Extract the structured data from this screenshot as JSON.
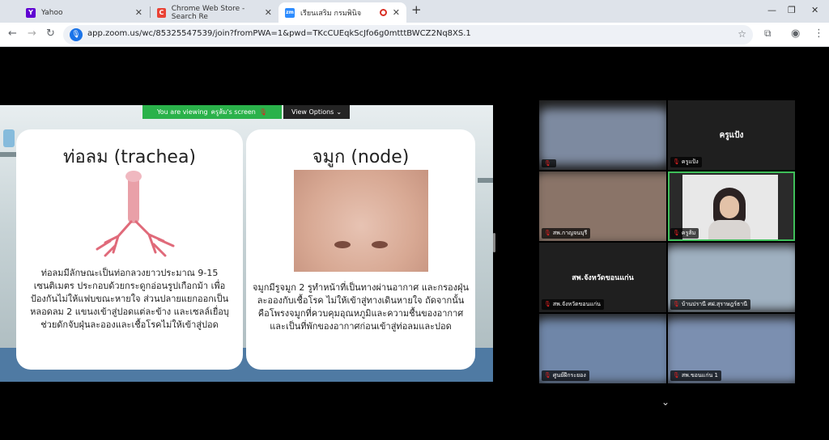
{
  "browser": {
    "tabs": [
      {
        "title": "Yahoo",
        "favicon": "Y"
      },
      {
        "title": "Chrome Web Store - Search Re",
        "favicon": "C"
      },
      {
        "title": "เรียนเสริม กรมพินิจ",
        "favicon": "zm"
      }
    ],
    "new_tab_label": "+",
    "url": "app.zoom.us/wc/85325547539/join?fromPWA=1&pwd=TKcCUEqkScJfo6g0mtttBWCZ2Nq8XS.1"
  },
  "share": {
    "viewing_prefix": "You are viewing",
    "viewing_name": "ครูส้ม's screen",
    "view_options_label": "View Options"
  },
  "slide": {
    "left_card": {
      "title": "ท่อลม (trachea)",
      "body": "ท่อลมมีลักษณะเป็นท่อกลวงยาวประมาณ 9-15 เซนติเมตร ประกอบด้วยกระดูกอ่อนรูปเกือกม้า เพื่อป้องกันไม่ให้แฟบขณะหายใจ ส่วนปลายแยกออกเป็นหลอดลม 2 แขนงเข้าสู่ปอดแต่ละข้าง และเซลล์เยื่อบุช่วยดักจับฝุ่นละอองและเชื้อโรคไม่ให้เข้าสู่ปอด"
    },
    "right_card": {
      "title": "จมูก (node)",
      "body": "จมูกมีรูจมูก 2 รูทำหน้าที่เป็นทางผ่านอากาศ และกรองฝุ่นละอองกับเชื้อโรค ไม่ให้เข้าสู่ทางเดินหายใจ ถัดจากนั้นคือโพรงจมูกที่ควบคุมอุณหภูมิและความชื้นของอากาศ และเป็นที่พักของอากาศก่อนเข้าสู่ท่อลมและปอด"
    }
  },
  "participants": [
    {
      "name": "",
      "center_name": "",
      "muted": true
    },
    {
      "name": "ครูแป้ง",
      "center_name": "ครูแป้ง",
      "muted": true
    },
    {
      "name": "สพ.กาญจนบุรี",
      "center_name": "",
      "muted": true
    },
    {
      "name": "ครูส้ม",
      "center_name": "",
      "muted": true,
      "active": true
    },
    {
      "name": "สพ.จังหวัดขอนแก่น",
      "center_name": "สพ.จังหวัดขอนแก่น",
      "muted": true
    },
    {
      "name": "บ้านปรานี ศฝ.สุราษฎร์ธานี",
      "center_name": "",
      "muted": true
    },
    {
      "name": "ศูนย์ฝึกระยอง",
      "center_name": "",
      "muted": true
    },
    {
      "name": "สพ.ขอนแก่น 1",
      "center_name": "",
      "muted": true
    }
  ],
  "colors": {
    "active_speaker": "#3fbf5a",
    "viewing_banner": "#2ab24a"
  }
}
